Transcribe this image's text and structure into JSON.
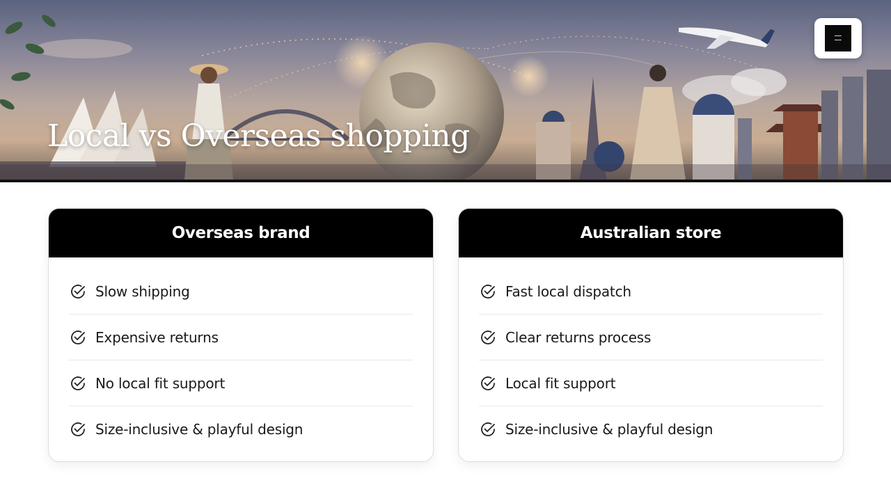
{
  "hero": {
    "title": "Local vs Overseas shopping",
    "logo_icon": "brand-logo"
  },
  "colors": {
    "header_bg": "#000000",
    "header_text": "#ffffff",
    "item_text": "#1a1a1a",
    "divider": "#e8e8e8"
  },
  "cards": [
    {
      "title": "Overseas brand",
      "items": [
        {
          "label": "Slow shipping",
          "icon": "check-circle-icon"
        },
        {
          "label": "Expensive returns",
          "icon": "check-circle-icon"
        },
        {
          "label": "No local fit support",
          "icon": "check-circle-icon"
        },
        {
          "label": "Size-inclusive & playful design",
          "icon": "check-circle-icon"
        }
      ]
    },
    {
      "title": "Australian store",
      "items": [
        {
          "label": "Fast local dispatch",
          "icon": "check-circle-icon"
        },
        {
          "label": "Clear returns process",
          "icon": "check-circle-icon"
        },
        {
          "label": "Local fit support",
          "icon": "check-circle-icon"
        },
        {
          "label": "Size-inclusive & playful design",
          "icon": "check-circle-icon"
        }
      ]
    }
  ]
}
